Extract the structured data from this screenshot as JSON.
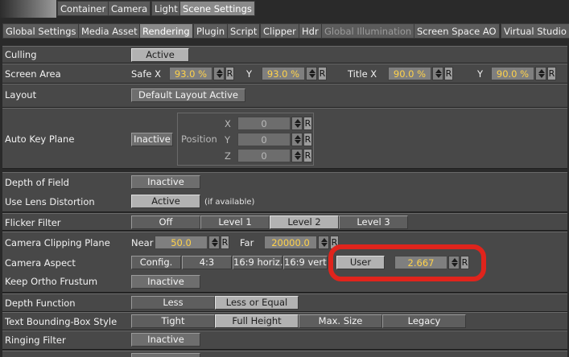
{
  "top_tabs": [
    "Container",
    "Camera",
    "Light",
    "Scene Settings"
  ],
  "sub_tabs": [
    "Global Settings",
    "Media Asset",
    "Rendering",
    "Plugin",
    "Script",
    "Clipper",
    "Hdr",
    "Global Illumination",
    "Screen Space AO",
    "Virtual Studio"
  ],
  "culling": {
    "label": "Culling",
    "button": "Active"
  },
  "screen_area": {
    "label": "Screen Area",
    "safe_x_label": "Safe X",
    "safe_x": "93.0 %",
    "y1_label": "Y",
    "y1": "93.0 %",
    "title_x_label": "Title X",
    "title_x": "90.0 %",
    "y2_label": "Y",
    "y2": "90.0 %",
    "reset": "R"
  },
  "layout": {
    "label": "Layout",
    "button": "Default Layout Active"
  },
  "auto_key_plane": {
    "label": "Auto Key Plane",
    "button": "Inactive",
    "position_label": "Position",
    "x_label": "X",
    "x": "0",
    "y_label": "Y",
    "y": "0",
    "z_label": "Z",
    "z": "0",
    "reset": "R"
  },
  "depth_of_field": {
    "label": "Depth of Field",
    "button": "Inactive"
  },
  "lens_distortion": {
    "label": "Use Lens Distortion",
    "button": "Active",
    "note": "(if available)"
  },
  "flicker_filter": {
    "label": "Flicker Filter",
    "options": [
      "Off",
      "Level 1",
      "Level 2",
      "Level 3"
    ],
    "selected": "Level 2"
  },
  "clipping_plane": {
    "label": "Camera Clipping Plane",
    "near_label": "Near",
    "near": "50.0",
    "far_label": "Far",
    "far": "20000.0",
    "reset": "R"
  },
  "camera_aspect": {
    "label": "Camera Aspect",
    "options": [
      "Config.",
      "4:3",
      "16:9 horiz.",
      "16:9 vert.",
      "User"
    ],
    "selected": "User",
    "value": "2.667",
    "reset": "R"
  },
  "ortho_frustum": {
    "label": "Keep Ortho Frustum",
    "button": "Inactive"
  },
  "depth_function": {
    "label": "Depth Function",
    "options": [
      "Less",
      "Less or Equal"
    ],
    "selected": "Less or Equal"
  },
  "text_bbox": {
    "label": "Text Bounding-Box Style",
    "options": [
      "Tight",
      "Full Height",
      "Max. Size",
      "Legacy"
    ],
    "selected": "Full Height"
  },
  "ringing_filter": {
    "label": "Ringing Filter",
    "button": "Inactive"
  },
  "colors": {
    "highlight": "#e0241c",
    "value_text": "#ffd24a",
    "panel": "#484848"
  }
}
